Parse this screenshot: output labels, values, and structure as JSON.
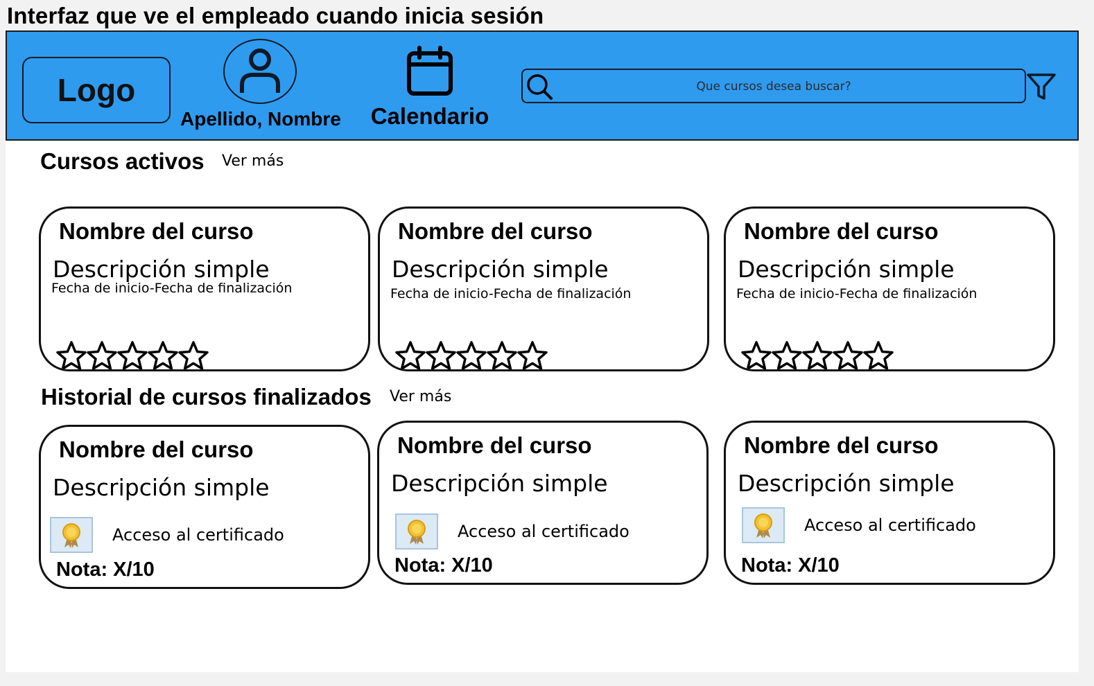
{
  "page_title": "Interfaz que ve el empleado cuando inicia sesión",
  "header": {
    "logo": "Logo",
    "user_name": "Apellido, Nombre",
    "calendar_label": "Calendario",
    "search_placeholder": "Que cursos desea buscar?",
    "icons": [
      "user-icon",
      "calendar-icon",
      "search-icon",
      "filter-icon"
    ]
  },
  "active_courses": {
    "title": "Cursos activos",
    "see_more": "Ver más",
    "cards": [
      {
        "name": "Nombre del curso",
        "description": "Descripción simple",
        "dates": "Fecha de inicio-Fecha de finalización",
        "stars": 0
      },
      {
        "name": "Nombre del curso",
        "description": "Descripción simple",
        "dates": "Fecha de inicio-Fecha de finalización",
        "stars": 0
      },
      {
        "name": "Nombre del curso",
        "description": "Descripción simple",
        "dates": "Fecha de inicio-Fecha de finalización",
        "stars": 0
      }
    ]
  },
  "finished_courses": {
    "title": "Historial de cursos finalizados",
    "see_more": "Ver más",
    "cards": [
      {
        "name": "Nombre del curso",
        "description": "Descripción simple",
        "certificate": "Acceso al certificado",
        "grade": "Nota: X/10"
      },
      {
        "name": "Nombre del curso",
        "description": "Descripción simple",
        "certificate": "Acceso al certificado",
        "grade": "Nota: X/10"
      },
      {
        "name": "Nombre del curso",
        "description": "Descripción simple",
        "certificate": "Acceso al certificado",
        "grade": "Nota: X/10"
      }
    ]
  },
  "colors": {
    "header_bg": "#2f9bef",
    "card_border": "#111111",
    "canvas": "#ffffff"
  }
}
